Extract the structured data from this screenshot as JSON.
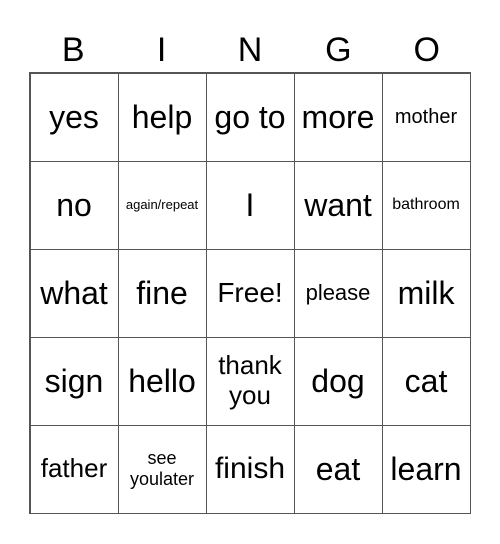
{
  "header": [
    "B",
    "I",
    "N",
    "G",
    "O"
  ],
  "cells": [
    {
      "text": "yes",
      "size": 32
    },
    {
      "text": "help",
      "size": 32
    },
    {
      "text": "go to",
      "size": 32
    },
    {
      "text": "more",
      "size": 32
    },
    {
      "text": "mother",
      "size": 20
    },
    {
      "text": "no",
      "size": 32
    },
    {
      "text": "again/repeat",
      "size": 13
    },
    {
      "text": "I",
      "size": 32
    },
    {
      "text": "want",
      "size": 32
    },
    {
      "text": "bathroom",
      "size": 16
    },
    {
      "text": "what",
      "size": 32
    },
    {
      "text": "fine",
      "size": 32
    },
    {
      "text": "Free!",
      "size": 28
    },
    {
      "text": "please",
      "size": 22
    },
    {
      "text": "milk",
      "size": 32
    },
    {
      "text": "sign",
      "size": 32
    },
    {
      "text": "hello",
      "size": 32
    },
    {
      "text": "thank you",
      "size": 26
    },
    {
      "text": "dog",
      "size": 32
    },
    {
      "text": "cat",
      "size": 32
    },
    {
      "text": "father",
      "size": 26
    },
    {
      "text": "see youlater",
      "size": 18
    },
    {
      "text": "finish",
      "size": 30
    },
    {
      "text": "eat",
      "size": 32
    },
    {
      "text": "learn",
      "size": 32
    }
  ]
}
